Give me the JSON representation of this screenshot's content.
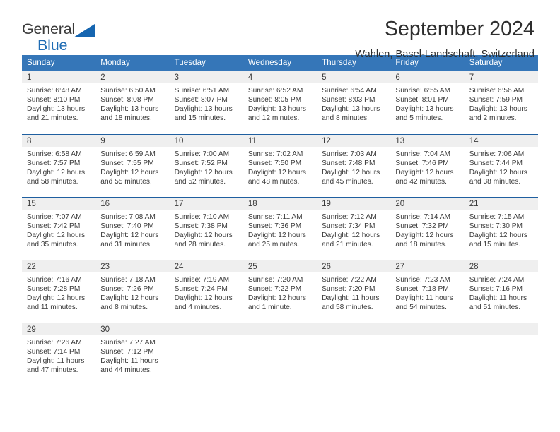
{
  "brand": {
    "logo_line1": "General",
    "logo_line2": "Blue",
    "logo_icon": "triangle-icon",
    "color_dark": "#3b3b3b",
    "color_blue": "#1f6cb4"
  },
  "header": {
    "title": "September 2024",
    "subtitle": "Wahlen, Basel-Landschaft, Switzerland"
  },
  "theme": {
    "header_bg": "#3576b8",
    "header_text": "#ffffff",
    "daynum_band_bg": "#efefef",
    "row_border": "#1f5fa0",
    "body_text": "#3a3a3a"
  },
  "labels": {
    "sunrise_prefix": "Sunrise:",
    "sunset_prefix": "Sunset:",
    "daylight_prefix": "Daylight:"
  },
  "weekdays": [
    "Sunday",
    "Monday",
    "Tuesday",
    "Wednesday",
    "Thursday",
    "Friday",
    "Saturday"
  ],
  "weeks": [
    [
      {
        "day": "1",
        "sunrise": "Sunrise: 6:48 AM",
        "sunset": "Sunset: 8:10 PM",
        "daylight_l1": "Daylight: 13 hours",
        "daylight_l2": "and 21 minutes."
      },
      {
        "day": "2",
        "sunrise": "Sunrise: 6:50 AM",
        "sunset": "Sunset: 8:08 PM",
        "daylight_l1": "Daylight: 13 hours",
        "daylight_l2": "and 18 minutes."
      },
      {
        "day": "3",
        "sunrise": "Sunrise: 6:51 AM",
        "sunset": "Sunset: 8:07 PM",
        "daylight_l1": "Daylight: 13 hours",
        "daylight_l2": "and 15 minutes."
      },
      {
        "day": "4",
        "sunrise": "Sunrise: 6:52 AM",
        "sunset": "Sunset: 8:05 PM",
        "daylight_l1": "Daylight: 13 hours",
        "daylight_l2": "and 12 minutes."
      },
      {
        "day": "5",
        "sunrise": "Sunrise: 6:54 AM",
        "sunset": "Sunset: 8:03 PM",
        "daylight_l1": "Daylight: 13 hours",
        "daylight_l2": "and 8 minutes."
      },
      {
        "day": "6",
        "sunrise": "Sunrise: 6:55 AM",
        "sunset": "Sunset: 8:01 PM",
        "daylight_l1": "Daylight: 13 hours",
        "daylight_l2": "and 5 minutes."
      },
      {
        "day": "7",
        "sunrise": "Sunrise: 6:56 AM",
        "sunset": "Sunset: 7:59 PM",
        "daylight_l1": "Daylight: 13 hours",
        "daylight_l2": "and 2 minutes."
      }
    ],
    [
      {
        "day": "8",
        "sunrise": "Sunrise: 6:58 AM",
        "sunset": "Sunset: 7:57 PM",
        "daylight_l1": "Daylight: 12 hours",
        "daylight_l2": "and 58 minutes."
      },
      {
        "day": "9",
        "sunrise": "Sunrise: 6:59 AM",
        "sunset": "Sunset: 7:55 PM",
        "daylight_l1": "Daylight: 12 hours",
        "daylight_l2": "and 55 minutes."
      },
      {
        "day": "10",
        "sunrise": "Sunrise: 7:00 AM",
        "sunset": "Sunset: 7:52 PM",
        "daylight_l1": "Daylight: 12 hours",
        "daylight_l2": "and 52 minutes."
      },
      {
        "day": "11",
        "sunrise": "Sunrise: 7:02 AM",
        "sunset": "Sunset: 7:50 PM",
        "daylight_l1": "Daylight: 12 hours",
        "daylight_l2": "and 48 minutes."
      },
      {
        "day": "12",
        "sunrise": "Sunrise: 7:03 AM",
        "sunset": "Sunset: 7:48 PM",
        "daylight_l1": "Daylight: 12 hours",
        "daylight_l2": "and 45 minutes."
      },
      {
        "day": "13",
        "sunrise": "Sunrise: 7:04 AM",
        "sunset": "Sunset: 7:46 PM",
        "daylight_l1": "Daylight: 12 hours",
        "daylight_l2": "and 42 minutes."
      },
      {
        "day": "14",
        "sunrise": "Sunrise: 7:06 AM",
        "sunset": "Sunset: 7:44 PM",
        "daylight_l1": "Daylight: 12 hours",
        "daylight_l2": "and 38 minutes."
      }
    ],
    [
      {
        "day": "15",
        "sunrise": "Sunrise: 7:07 AM",
        "sunset": "Sunset: 7:42 PM",
        "daylight_l1": "Daylight: 12 hours",
        "daylight_l2": "and 35 minutes."
      },
      {
        "day": "16",
        "sunrise": "Sunrise: 7:08 AM",
        "sunset": "Sunset: 7:40 PM",
        "daylight_l1": "Daylight: 12 hours",
        "daylight_l2": "and 31 minutes."
      },
      {
        "day": "17",
        "sunrise": "Sunrise: 7:10 AM",
        "sunset": "Sunset: 7:38 PM",
        "daylight_l1": "Daylight: 12 hours",
        "daylight_l2": "and 28 minutes."
      },
      {
        "day": "18",
        "sunrise": "Sunrise: 7:11 AM",
        "sunset": "Sunset: 7:36 PM",
        "daylight_l1": "Daylight: 12 hours",
        "daylight_l2": "and 25 minutes."
      },
      {
        "day": "19",
        "sunrise": "Sunrise: 7:12 AM",
        "sunset": "Sunset: 7:34 PM",
        "daylight_l1": "Daylight: 12 hours",
        "daylight_l2": "and 21 minutes."
      },
      {
        "day": "20",
        "sunrise": "Sunrise: 7:14 AM",
        "sunset": "Sunset: 7:32 PM",
        "daylight_l1": "Daylight: 12 hours",
        "daylight_l2": "and 18 minutes."
      },
      {
        "day": "21",
        "sunrise": "Sunrise: 7:15 AM",
        "sunset": "Sunset: 7:30 PM",
        "daylight_l1": "Daylight: 12 hours",
        "daylight_l2": "and 15 minutes."
      }
    ],
    [
      {
        "day": "22",
        "sunrise": "Sunrise: 7:16 AM",
        "sunset": "Sunset: 7:28 PM",
        "daylight_l1": "Daylight: 12 hours",
        "daylight_l2": "and 11 minutes."
      },
      {
        "day": "23",
        "sunrise": "Sunrise: 7:18 AM",
        "sunset": "Sunset: 7:26 PM",
        "daylight_l1": "Daylight: 12 hours",
        "daylight_l2": "and 8 minutes."
      },
      {
        "day": "24",
        "sunrise": "Sunrise: 7:19 AM",
        "sunset": "Sunset: 7:24 PM",
        "daylight_l1": "Daylight: 12 hours",
        "daylight_l2": "and 4 minutes."
      },
      {
        "day": "25",
        "sunrise": "Sunrise: 7:20 AM",
        "sunset": "Sunset: 7:22 PM",
        "daylight_l1": "Daylight: 12 hours",
        "daylight_l2": "and 1 minute."
      },
      {
        "day": "26",
        "sunrise": "Sunrise: 7:22 AM",
        "sunset": "Sunset: 7:20 PM",
        "daylight_l1": "Daylight: 11 hours",
        "daylight_l2": "and 58 minutes."
      },
      {
        "day": "27",
        "sunrise": "Sunrise: 7:23 AM",
        "sunset": "Sunset: 7:18 PM",
        "daylight_l1": "Daylight: 11 hours",
        "daylight_l2": "and 54 minutes."
      },
      {
        "day": "28",
        "sunrise": "Sunrise: 7:24 AM",
        "sunset": "Sunset: 7:16 PM",
        "daylight_l1": "Daylight: 11 hours",
        "daylight_l2": "and 51 minutes."
      }
    ],
    [
      {
        "day": "29",
        "sunrise": "Sunrise: 7:26 AM",
        "sunset": "Sunset: 7:14 PM",
        "daylight_l1": "Daylight: 11 hours",
        "daylight_l2": "and 47 minutes."
      },
      {
        "day": "30",
        "sunrise": "Sunrise: 7:27 AM",
        "sunset": "Sunset: 7:12 PM",
        "daylight_l1": "Daylight: 11 hours",
        "daylight_l2": "and 44 minutes."
      },
      {
        "day": "",
        "sunrise": "",
        "sunset": "",
        "daylight_l1": "",
        "daylight_l2": ""
      },
      {
        "day": "",
        "sunrise": "",
        "sunset": "",
        "daylight_l1": "",
        "daylight_l2": ""
      },
      {
        "day": "",
        "sunrise": "",
        "sunset": "",
        "daylight_l1": "",
        "daylight_l2": ""
      },
      {
        "day": "",
        "sunrise": "",
        "sunset": "",
        "daylight_l1": "",
        "daylight_l2": ""
      },
      {
        "day": "",
        "sunrise": "",
        "sunset": "",
        "daylight_l1": "",
        "daylight_l2": ""
      }
    ]
  ]
}
